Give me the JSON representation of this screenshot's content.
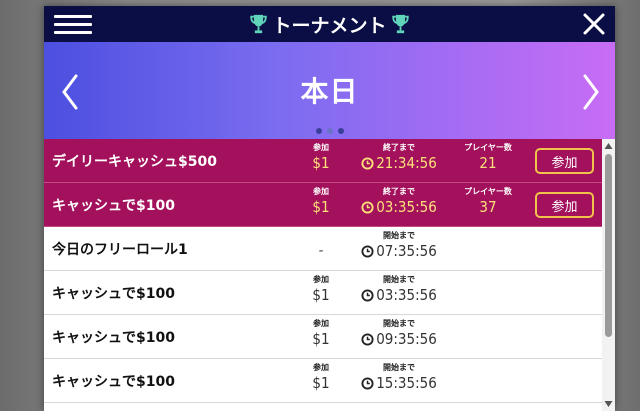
{
  "header": {
    "title": "トーナメント",
    "menu_icon": "hamburger-icon",
    "trophy_icon": "trophy-icon",
    "close_icon": "close-icon",
    "bar_color": "#0b0e44"
  },
  "hero": {
    "title": "本日",
    "prev_icon": "chevron-left-icon",
    "next_icon": "chevron-right-icon",
    "page_dots": 3,
    "active_dot": 1
  },
  "colors": {
    "featured_row": "#a3115c",
    "accent_yellow": "#ffe07a",
    "button_border": "#f0c34a"
  },
  "tournaments": [
    {
      "name": "デイリーキャッシュ$500",
      "featured": true,
      "entry_label": "参加",
      "entry_value": "$1",
      "time_label": "終了まで",
      "time_value": "21:34:56",
      "players_label": "プレイヤー数",
      "players_value": "21",
      "join_label": "参加"
    },
    {
      "name": "キャッシュで$100",
      "featured": true,
      "entry_label": "参加",
      "entry_value": "$1",
      "time_label": "終了まで",
      "time_value": "03:35:56",
      "players_label": "プレイヤー数",
      "players_value": "37",
      "join_label": "参加"
    },
    {
      "name": "今日のフリーロール1",
      "featured": false,
      "entry_value": "-",
      "time_label": "開始まで",
      "time_value": "07:35:56"
    },
    {
      "name": "キャッシュで$100",
      "featured": false,
      "entry_label": "参加",
      "entry_value": "$1",
      "time_label": "開始まで",
      "time_value": "03:35:56"
    },
    {
      "name": "キャッシュで$100",
      "featured": false,
      "entry_label": "参加",
      "entry_value": "$1",
      "time_label": "開始まで",
      "time_value": "09:35:56"
    },
    {
      "name": "キャッシュで$100",
      "featured": false,
      "entry_label": "参加",
      "entry_value": "$1",
      "time_label": "開始まで",
      "time_value": "15:35:56"
    }
  ]
}
